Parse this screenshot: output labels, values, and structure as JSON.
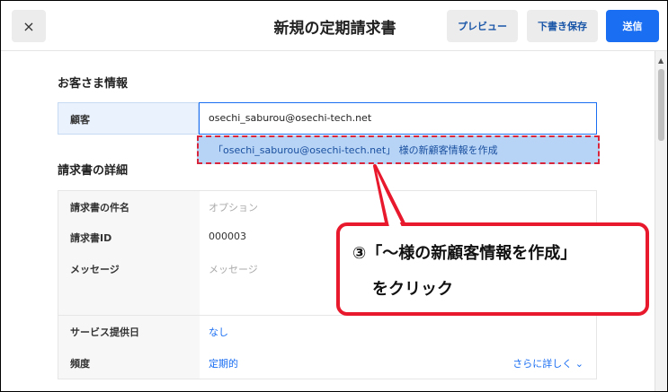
{
  "header": {
    "close_glyph": "×",
    "title": "新規の定期請求書",
    "preview_label": "プレビュー",
    "draft_label": "下書き保存",
    "send_label": "送信"
  },
  "customer_section": {
    "title": "お客さま情報",
    "customer_label": "顧客",
    "customer_value": "osechi_saburou@osechi-tech.net",
    "suggestion": "「osechi_saburou@osechi-tech.net」 様の新顧客情報を作成"
  },
  "details_section": {
    "title": "請求書の詳細",
    "rows": [
      {
        "label": "請求書の件名",
        "value": "オプション"
      },
      {
        "label": "請求書ID",
        "value": "000003"
      },
      {
        "label": "メッセージ",
        "value": "メッセージ"
      },
      {
        "label": "サービス提供日",
        "value": "なし"
      },
      {
        "label": "頻度",
        "value": "定期的",
        "more": "さらに詳しく ⌄"
      }
    ]
  },
  "callout": {
    "line1": "③「～様の新顧客情報を作成」",
    "line2": "をクリック"
  },
  "colors": {
    "accent": "#1a6ef2",
    "annotation_red": "#e8192c"
  }
}
